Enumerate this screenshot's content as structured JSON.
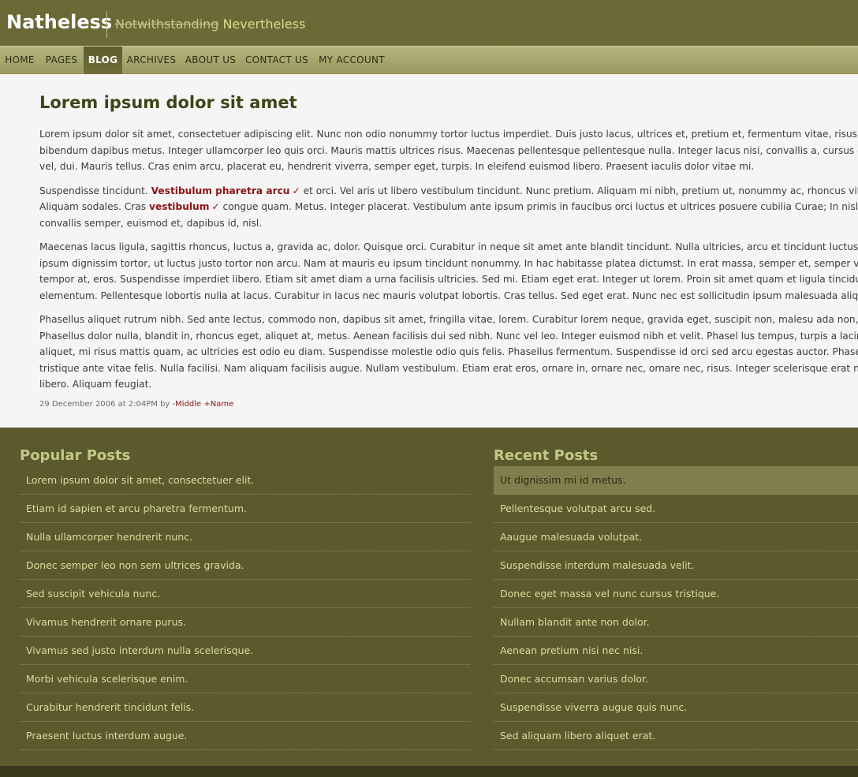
{
  "site": {
    "title": "Natheless",
    "tagline_strike": "Notwithstanding",
    "tagline": "Nevertheless"
  },
  "nav": {
    "items": [
      {
        "label": "HOME",
        "active": false
      },
      {
        "label": "PAGES",
        "active": false
      },
      {
        "label": "BLOG",
        "active": true
      },
      {
        "label": "ARCHIVES",
        "active": false
      },
      {
        "label": "ABOUT US",
        "active": false
      },
      {
        "label": "CONTACT US",
        "active": false
      },
      {
        "label": "MY ACCOUNT",
        "active": false
      }
    ]
  },
  "post": {
    "title": "Lorem ipsum dolor sit amet",
    "p1": [
      "Lorem ipsum dolor sit amet, consectetuer adipiscing elit. Nunc non odio nonummy tortor luctus imperdiet. Duis justo lacus, ultrices et, pretium et, fermentum vitae, risus. Prae",
      "bibendum dapibus metus. Integer ullamcorper leo quis orci. Mauris mattis ultrices risus. Maecenas pellentesque pellentesque nulla. Integer lacus nisi, convallis a, cursus eu, laci",
      "vel, dui. Mauris tellus. Cras enim arcu, placerat eu, hendrerit viverra, semper eget, turpis. In eleifend euismod libero. Praesent iaculis dolor vitae mi."
    ],
    "p2": {
      "l1_a": "Suspendisse tincidunt.",
      "l1_link": "Vestibulum pharetra arcu",
      "l1_b": "et orci. Vel aris ut libero vestibulum tincidunt. Nunc pretium. Aliquam mi nibh, pretium ut, nonummy ac, rhoncus vitae, nu",
      "l2_a": "Aliquam sodales. Cras",
      "l2_link": "vestibulum",
      "l2_b": "congue quam. Metus. Integer placerat. Vestibulum ante ipsum primis in faucibus orci luctus et ultrices posuere cubilia Curae; In nisl lacus,",
      "l3": "convallis semper, euismod et, dapibus id, nisl."
    },
    "p3": [
      "Maecenas lacus ligula, sagittis rhoncus, luctus a, gravida ac, dolor. Quisque orci. Curabitur in neque sit amet ante blandit tincidunt. Nulla ultricies, arcu et tincidunt luctus, eros",
      "ipsum dignissim tortor, ut luctus justo tortor non arcu. Nam at mauris eu ipsum tincidunt nonummy. In hac habitasse platea dictumst. In erat massa, semper et, semper varius,",
      "tempor at, eros. Suspendisse imperdiet libero. Etiam sit amet diam a urna facilisis ultricies. Sed mi. Etiam eget erat. Integer ut lorem. Proin sit amet quam et ligula tincidunt",
      "elementum. Pellentesque lobortis nulla at lacus. Curabitur in lacus nec mauris volutpat lobortis. Cras tellus. Sed eget erat. Nunc nec est sollicitudin ipsum malesuada aliquet."
    ],
    "p4": [
      "Phasellus aliquet rutrum nibh. Sed ante lectus, commodo non, dapibus sit amet, fringilla vitae, lorem. Curabitur lorem neque, gravida eget, suscipit non, malesu ada non, quam",
      "Phasellus dolor nulla, blandit in, rhoncus eget, aliquet at, metus. Aenean facilisis dui sed nibh. Nunc vel leo. Integer euismod nibh et velit. Phasel lus tempus, turpis a lacinia",
      "aliquet, mi risus mattis quam, ac ultricies est odio eu diam. Suspendisse molestie odio quis felis. Phasellus fermentum. Suspendisse id orci sed arcu egestas auctor. Phasellus",
      "tristique ante vitae felis. Nulla facilisi. Nam aliquam facilisis augue. Nullam vestibulum. Etiam erat eros, ornare in, ornare nec, ornare nec, risus. Integer scelerisque erat nec",
      "libero. Aliquam feugiat."
    ],
    "meta_date": "29 December 2006 at 2:04PM by",
    "meta_author": "-Middle +Name"
  },
  "popular": {
    "heading": "Popular Posts",
    "items": [
      "Lorem ipsum dolor sit amet, consectetuer elit.",
      "Etiam id sapien et arcu pharetra fermentum.",
      "Nulla ullamcorper hendrerit nunc.",
      "Donec semper leo non sem ultrices gravida.",
      "Sed suscipit vehicula nunc.",
      "Vivamus hendrerit ornare purus.",
      "Vivamus sed justo interdum nulla scelerisque.",
      "Morbi vehicula scelerisque enim.",
      "Curabitur hendrerit tincidunt felis.",
      "Praesent luctus interdum augue."
    ]
  },
  "recent": {
    "heading": "Recent Posts",
    "items": [
      "Ut dignissim mi id metus.",
      "Pellentesque volutpat arcu sed.",
      "Aaugue malesuada volutpat.",
      "Suspendisse interdum malesuada velit.",
      "Donec eget massa vel nunc cursus tristique.",
      "Nullam blandit ante non dolor.",
      "Aenean pretium nisi nec nisi.",
      "Donec accumsan varius dolor.",
      "Suspendisse viverra augue quis nunc.",
      "Sed aliquam libero aliquet erat."
    ]
  },
  "colors": {
    "header_bg": "#6b6a37",
    "nav_bg": "#a8a870",
    "link": "#8b1414",
    "footer_bg": "#5b5a2d"
  }
}
